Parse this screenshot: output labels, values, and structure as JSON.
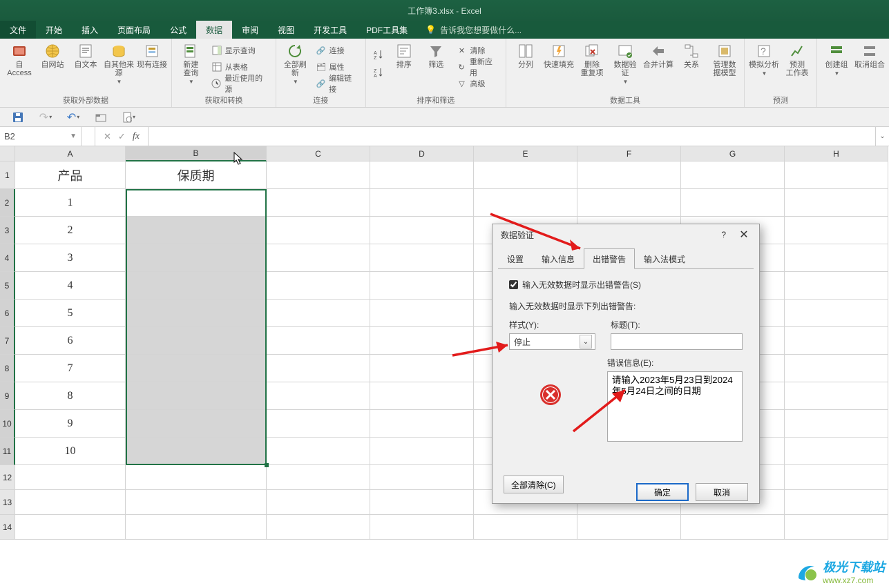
{
  "title": {
    "doc": "工作簿3.xlsx",
    "app": "Excel"
  },
  "tabs": [
    "文件",
    "开始",
    "插入",
    "页面布局",
    "公式",
    "数据",
    "审阅",
    "视图",
    "开发工具",
    "PDF工具集"
  ],
  "tell_me": "告诉我您想要做什么...",
  "ribbon": {
    "ext": {
      "access": "自 Access",
      "web": "自网站",
      "text": "自文本",
      "other": "自其他来源",
      "existing": "现有连接",
      "label": "获取外部数据"
    },
    "xform": {
      "newq": "新建\n查询",
      "show": "显示查询",
      "fromtbl": "从表格",
      "recent": "最近使用的源",
      "label": "获取和转换"
    },
    "conn": {
      "refresh": "全部刷新",
      "c_conn": "连接",
      "c_prop": "属性",
      "c_edit": "编辑链接",
      "label": "连接"
    },
    "sort": {
      "asc": "升序",
      "desc": "降序",
      "sort": "排序",
      "filter": "筛选",
      "clear": "清除",
      "reapply": "重新应用",
      "adv": "高级",
      "label": "排序和筛选"
    },
    "tools": {
      "col": "分列",
      "flash": "快速填充",
      "dup": "删除\n重复项",
      "valid": "数据验\n证",
      "cons": "合并计算",
      "rel": "关系",
      "model": "管理数\n据模型",
      "label": "数据工具"
    },
    "forecast": {
      "wia": "模拟分析",
      "sheet": "预测\n工作表",
      "label": "预测"
    },
    "outline": {
      "grp": "创建组",
      "ungrp": "取消组合",
      "label": ""
    }
  },
  "namebox": "B2",
  "columns": [
    "A",
    "B",
    "C",
    "D",
    "E",
    "F",
    "G",
    "H"
  ],
  "rows": [
    "1",
    "2",
    "3",
    "4",
    "5",
    "6",
    "7",
    "8",
    "9",
    "10",
    "11",
    "12",
    "13",
    "14"
  ],
  "sheet": {
    "A1": "产品",
    "B1": "保质期",
    "A2": "1",
    "A3": "2",
    "A4": "3",
    "A5": "4",
    "A6": "5",
    "A7": "6",
    "A8": "7",
    "A9": "8",
    "A10": "9",
    "A11": "10"
  },
  "dialog": {
    "title": "数据验证",
    "help": "?",
    "tabs": [
      "设置",
      "输入信息",
      "出错警告",
      "输入法模式"
    ],
    "chk": "输入无效数据时显示出错警告(S)",
    "section": "输入无效数据时显示下列出错警告:",
    "style": "样式(Y):",
    "style_val": "停止",
    "title_lbl": "标题(T):",
    "err_lbl": "错误信息(E):",
    "err_val": "请输入2023年5月23日到2024年5月24日之间的日期",
    "clear": "全部清除(C)",
    "ok": "确定",
    "cancel": "取消"
  },
  "watermark": {
    "t1": "极光下载站",
    "t2": "www.xz7.com"
  }
}
